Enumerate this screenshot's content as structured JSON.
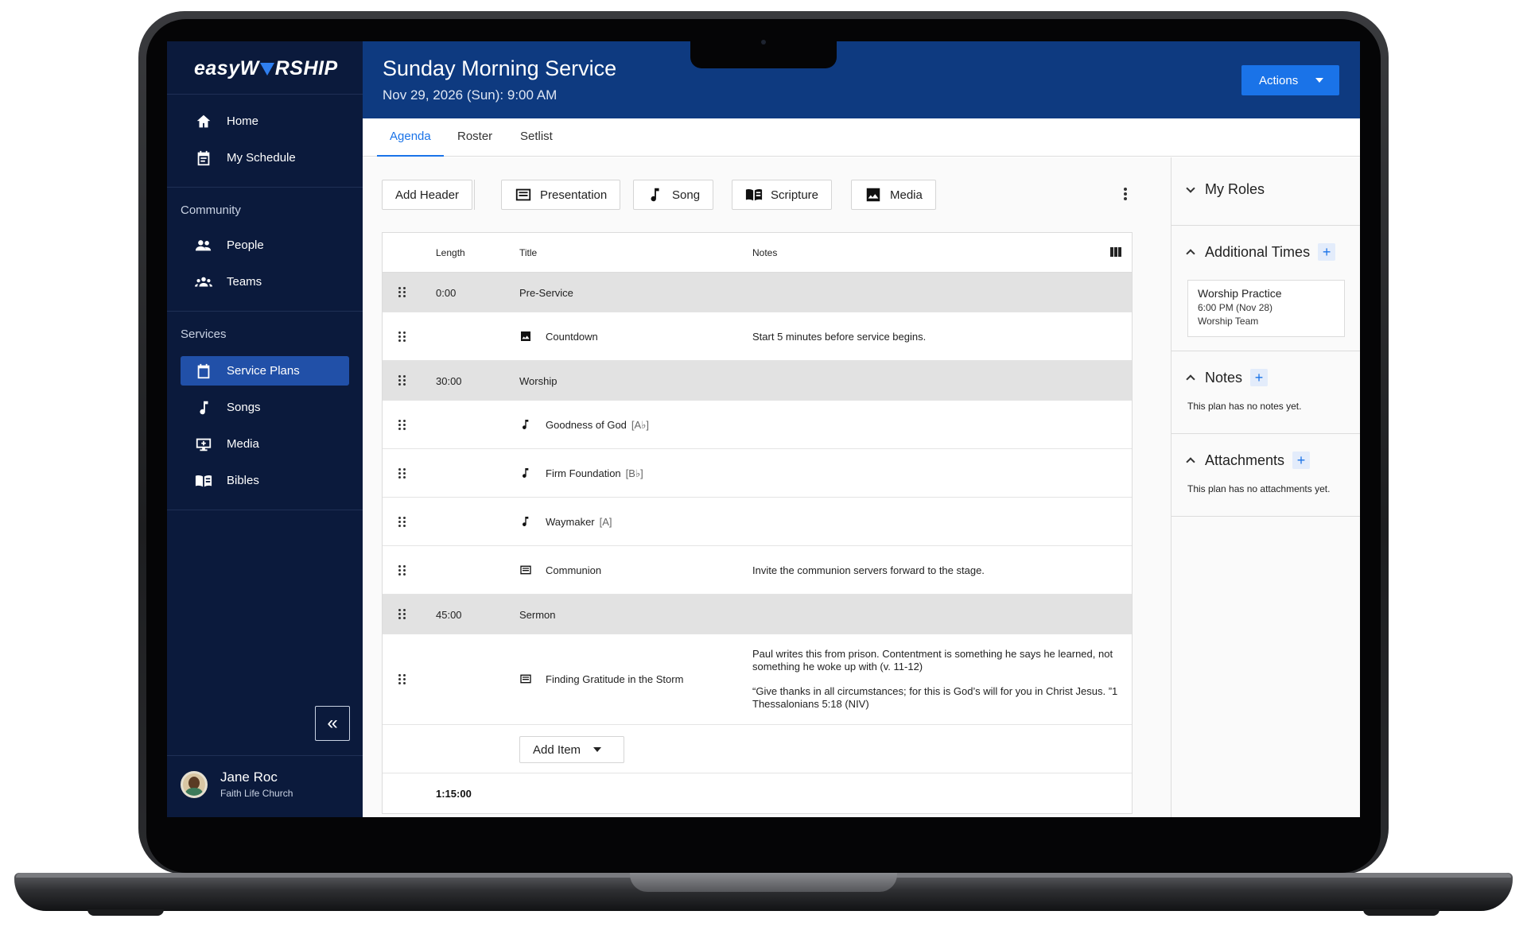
{
  "brand": {
    "logo_left": "easyW",
    "logo_right": "RSHIP"
  },
  "sidebar": {
    "items_top": [
      {
        "label": "Home",
        "icon": "home-icon"
      },
      {
        "label": "My Schedule",
        "icon": "calendar-icon"
      }
    ],
    "community_label": "Community",
    "community_items": [
      {
        "label": "People",
        "icon": "people-icon"
      },
      {
        "label": "Teams",
        "icon": "groups-icon"
      }
    ],
    "services_label": "Services",
    "services_items": [
      {
        "label": "Service Plans",
        "icon": "calendar-icon",
        "active": true
      },
      {
        "label": "Songs",
        "icon": "music-note-icon"
      },
      {
        "label": "Media",
        "icon": "media-icon"
      },
      {
        "label": "Bibles",
        "icon": "book-icon"
      }
    ],
    "collapse_glyph": "«",
    "user": {
      "name": "Jane Roc",
      "org": "Faith Life Church"
    }
  },
  "header": {
    "title": "Sunday Morning Service",
    "subtitle": "Nov 29, 2026 (Sun): 9:00 AM",
    "actions_label": "Actions"
  },
  "tabs": [
    {
      "label": "Agenda",
      "active": true
    },
    {
      "label": "Roster",
      "active": false
    },
    {
      "label": "Setlist",
      "active": false
    }
  ],
  "toolbar": {
    "add_header": "Add Header",
    "presentation": "Presentation",
    "song": "Song",
    "scripture": "Scripture",
    "media": "Media"
  },
  "table": {
    "columns": {
      "length": "Length",
      "title": "Title",
      "notes": "Notes"
    },
    "rows": [
      {
        "type": "header",
        "length": "0:00",
        "title": "Pre-Service"
      },
      {
        "type": "item",
        "icon": "image-icon",
        "title": "Countdown",
        "notes": "Start 5 minutes before service begins."
      },
      {
        "type": "header",
        "length": "30:00",
        "title": "Worship"
      },
      {
        "type": "item",
        "icon": "music-note-icon",
        "title": "Goodness of God",
        "key": "[A♭]"
      },
      {
        "type": "item",
        "icon": "music-note-icon",
        "title": "Firm Foundation",
        "key": "[B♭]"
      },
      {
        "type": "item",
        "icon": "music-note-icon",
        "title": "Waymaker",
        "key": "[A]"
      },
      {
        "type": "item",
        "icon": "presentation-icon",
        "title": "Communion",
        "notes": "Invite the communion servers forward to the stage."
      },
      {
        "type": "header",
        "length": "45:00",
        "title": "Sermon"
      },
      {
        "type": "item",
        "icon": "presentation-icon",
        "title": "Finding Gratitude in the Storm",
        "notes_1": "Paul writes this from prison. Contentment is something he says he learned, not something he woke up with (v. 11-12)",
        "notes_2": "“Give thanks in all circumstances; for this is God’s will for you in Christ Jesus. ”1 Thessalonians 5:18 (NIV)"
      }
    ],
    "add_item_label": "Add Item",
    "total": "1:15:00"
  },
  "right_panel": {
    "my_roles": "My Roles",
    "additional_times": "Additional Times",
    "time_card": {
      "title": "Worship Practice",
      "time": "6:00 PM (Nov 28)",
      "team": "Worship Team"
    },
    "notes": "Notes",
    "notes_empty": "This plan has no notes yet.",
    "attachments": "Attachments",
    "attachments_empty": "This plan has no attachments yet.",
    "plus": "+"
  },
  "colors": {
    "sidebar": "#0b1a3c",
    "header": "#0e3a80",
    "accent": "#1a73e8",
    "active_nav": "#2150a8"
  }
}
